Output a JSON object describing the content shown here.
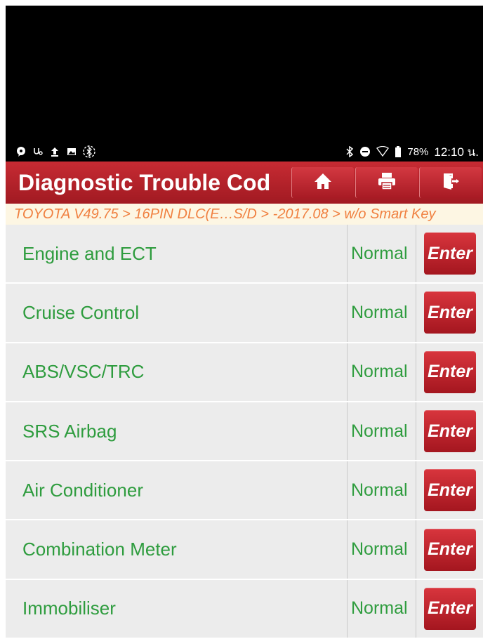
{
  "statusbar": {
    "left_icons": [
      "message-icon",
      "usb-debug-icon",
      "upload-icon",
      "image-icon",
      "bluetooth-scan-icon"
    ],
    "right_icons": [
      "bluetooth-icon",
      "dnd-icon",
      "wifi-icon",
      "battery-icon"
    ],
    "battery": "78%",
    "time": "12:10 น."
  },
  "header": {
    "title": "Diagnostic Trouble Cod",
    "buttons": [
      "home-icon",
      "print-icon",
      "exit-icon"
    ]
  },
  "breadcrumb": "TOYOTA V49.75 > 16PIN DLC(E…S/D > -2017.08 > w/o Smart Key",
  "systems": [
    {
      "name": "Engine and ECT",
      "status": "Normal",
      "action": "Enter"
    },
    {
      "name": "Cruise Control",
      "status": "Normal",
      "action": "Enter"
    },
    {
      "name": "ABS/VSC/TRC",
      "status": "Normal",
      "action": "Enter"
    },
    {
      "name": "SRS Airbag",
      "status": "Normal",
      "action": "Enter"
    },
    {
      "name": "Air Conditioner",
      "status": "Normal",
      "action": "Enter"
    },
    {
      "name": "Combination Meter",
      "status": "Normal",
      "action": "Enter"
    },
    {
      "name": "Immobiliser",
      "status": "Normal",
      "action": "Enter"
    }
  ],
  "colors": {
    "header_red": "#b82129",
    "text_green": "#2e9c3e",
    "breadcrumb_orange": "#f08040",
    "row_bg": "#ececec"
  }
}
